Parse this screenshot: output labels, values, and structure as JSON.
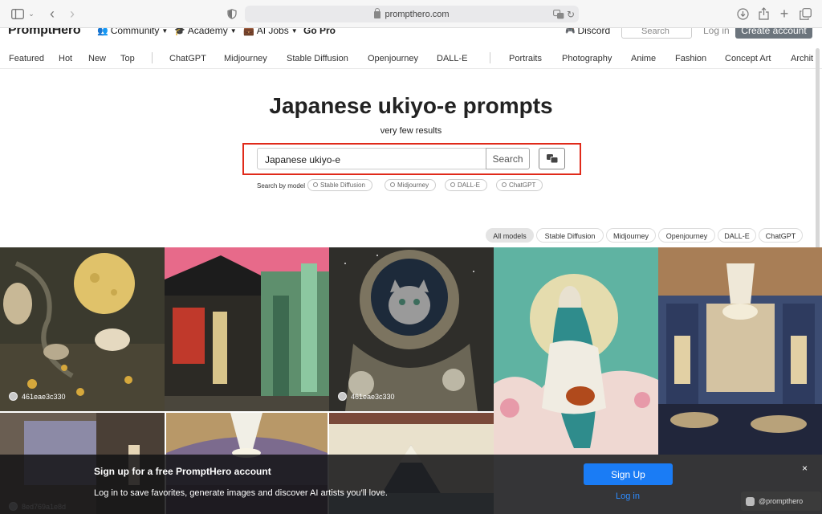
{
  "browser": {
    "url": "prompthero.com",
    "icons": [
      "sidebar-icon",
      "chevron-left-icon",
      "chevron-right-icon",
      "shield-icon",
      "lock-icon",
      "translate-icon",
      "reload-icon",
      "download-icon",
      "share-icon",
      "plus-icon",
      "tabs-icon"
    ]
  },
  "header": {
    "logo": "PromptHero",
    "nav": [
      {
        "label": "Community",
        "icon": "people-icon",
        "dropdown": true
      },
      {
        "label": "Academy",
        "icon": "graduation-cap-icon",
        "dropdown": true
      },
      {
        "label": "AI Jobs",
        "icon": "briefcase-icon",
        "dropdown": true
      },
      {
        "label": "Go Pro",
        "dropdown": false
      }
    ],
    "discord": "Discord",
    "search_placeholder": "Search",
    "login": "Log in",
    "create_account": "Create account"
  },
  "categories": {
    "group1": [
      "Featured",
      "Hot",
      "New",
      "Top"
    ],
    "group2": [
      "ChatGPT",
      "Midjourney",
      "Stable Diffusion",
      "Openjourney",
      "DALL-E"
    ],
    "group3": [
      "Portraits",
      "Photography",
      "Anime",
      "Fashion",
      "Concept Art",
      "Archit"
    ]
  },
  "hero": {
    "title": "Japanese ukiyo-e prompts",
    "subtitle": "very few results",
    "search_value": "Japanese ukiyo-e",
    "search_button": "Search",
    "search_by_model_label": "Search by model",
    "model_chips": [
      "Stable Diffusion",
      "Midjourney",
      "DALL-E",
      "ChatGPT"
    ]
  },
  "filters": {
    "chips": [
      "All models",
      "Stable Diffusion",
      "Midjourney",
      "Openjourney",
      "DALL-E",
      "ChatGPT"
    ],
    "active": "All models"
  },
  "gallery": {
    "authors": [
      "461eae3c330",
      "461eae3c330",
      "8ed769a1e8d"
    ]
  },
  "signup_banner": {
    "title": "Sign up for a free PromptHero account",
    "text": "Log in to save favorites, generate images and discover AI artists you'll love.",
    "signup_button": "Sign Up",
    "login_link": "Log in",
    "close": "×"
  },
  "watermark": "@prompthero",
  "colors": {
    "highlight_box": "#e02a1a",
    "signup_button": "#1a7cf5",
    "create_account_button": "#6c757d",
    "banner_background": "#141416"
  }
}
